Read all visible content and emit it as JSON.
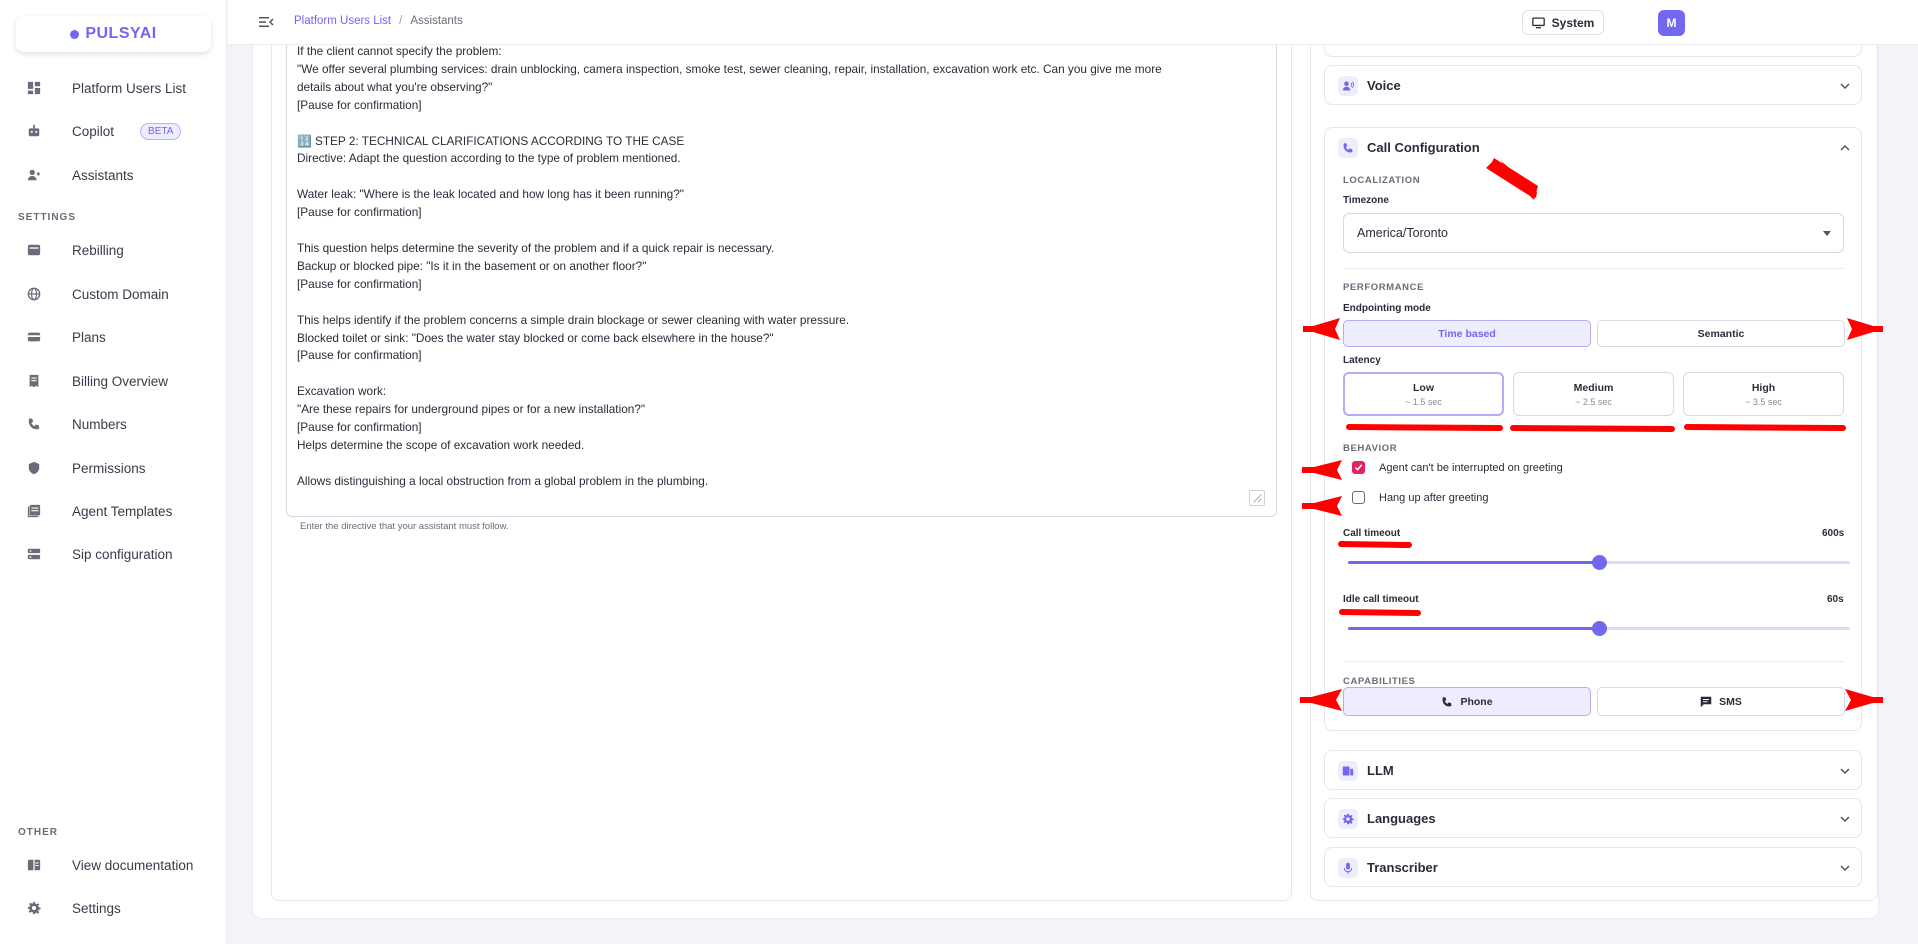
{
  "brand": {
    "name": "PULSYAI",
    "color": "#7367f0"
  },
  "sidebar": {
    "items": [
      {
        "label": "Platform Users List",
        "icon": "dashboard-icon"
      },
      {
        "label": "Copilot",
        "icon": "robot-icon",
        "badge": "BETA"
      },
      {
        "label": "Assistants",
        "icon": "user-add-icon"
      }
    ],
    "settings_label": "SETTINGS",
    "settings_items": [
      {
        "label": "Rebilling",
        "icon": "rebilling-icon"
      },
      {
        "label": "Custom Domain",
        "icon": "globe-icon"
      },
      {
        "label": "Plans",
        "icon": "card-icon"
      },
      {
        "label": "Billing Overview",
        "icon": "receipt-icon"
      },
      {
        "label": "Numbers",
        "icon": "phone-icon"
      },
      {
        "label": "Permissions",
        "icon": "shield-icon"
      },
      {
        "label": "Agent Templates",
        "icon": "templates-icon"
      },
      {
        "label": "Sip configuration",
        "icon": "server-icon"
      }
    ],
    "other_label": "OTHER",
    "other_items": [
      {
        "label": "View documentation",
        "icon": "book-icon"
      },
      {
        "label": "Settings",
        "icon": "gear-icon"
      }
    ]
  },
  "topbar": {
    "breadcrumb": [
      "Platform Users List",
      "/",
      "Assistants"
    ],
    "system_label": "System",
    "avatar_letter": "M"
  },
  "prompt": {
    "lines": [
      "If the client cannot specify the problem:",
      "\"We offer several plumbing services: drain unblocking, camera inspection, smoke test, sewer cleaning, repair, installation, excavation work etc. Can you give me more",
      "details about what you're observing?\"",
      "[Pause for confirmation]",
      "",
      "🔢 STEP 2: TECHNICAL CLARIFICATIONS ACCORDING TO THE CASE",
      "Directive: Adapt the question according to the type of problem mentioned.",
      "",
      "Water leak: \"Where is the leak located and how long has it been running?\"",
      "[Pause for confirmation]",
      "",
      "This question helps determine the severity of the problem and if a quick repair is necessary.",
      "Backup or blocked pipe: \"Is it in the basement or on another floor?\"",
      "[Pause for confirmation]",
      "",
      "This helps identify if the problem concerns a simple drain blockage or sewer cleaning with water pressure.",
      "Blocked toilet or sink: \"Does the water stay blocked or come back elsewhere in the house?\"",
      "[Pause for confirmation]",
      "",
      "Excavation work:",
      "\"Are these repairs for underground pipes or for a new installation?\"",
      "[Pause for confirmation]",
      "Helps determine the scope of excavation work needed.",
      "",
      "Allows distinguishing a local obstruction from a global problem in the plumbing."
    ],
    "helper": "Enter the directive that your assistant must follow."
  },
  "config": {
    "voice_title": "Voice",
    "call_title": "Call Configuration",
    "localization_label": "LOCALIZATION",
    "timezone_label": "Timezone",
    "timezone_value": "America/Toronto",
    "performance_label": "PERFORMANCE",
    "endpointing_label": "Endpointing mode",
    "endpointing_options": [
      "Time based",
      "Semantic"
    ],
    "endpointing_selected": "Time based",
    "latency_label": "Latency",
    "latency_options": [
      {
        "name": "Low",
        "sub": "~ 1.5 sec"
      },
      {
        "name": "Medium",
        "sub": "~ 2.5 sec"
      },
      {
        "name": "High",
        "sub": "~ 3.5 sec"
      }
    ],
    "latency_selected": "Low",
    "behavior_label": "BEHAVIOR",
    "behavior_options": [
      {
        "label": "Agent can't be interrupted on greeting",
        "checked": true
      },
      {
        "label": "Hang up after greeting",
        "checked": false
      }
    ],
    "call_timeout_label": "Call timeout",
    "call_timeout_value": "600s",
    "call_timeout_fraction": 0.5,
    "idle_timeout_label": "Idle call timeout",
    "idle_timeout_value": "60s",
    "idle_timeout_fraction": 0.5,
    "capabilities_label": "CAPABILITIES",
    "capabilities": [
      {
        "label": "Phone",
        "icon": "phone-call-icon",
        "active": true
      },
      {
        "label": "SMS",
        "icon": "message-icon",
        "active": false
      }
    ],
    "llm_title": "LLM",
    "languages_title": "Languages",
    "transcriber_title": "Transcriber"
  },
  "colors": {
    "accent": "#7367f0",
    "annotation": "#ff0000",
    "checkbox": "#e0245e"
  }
}
